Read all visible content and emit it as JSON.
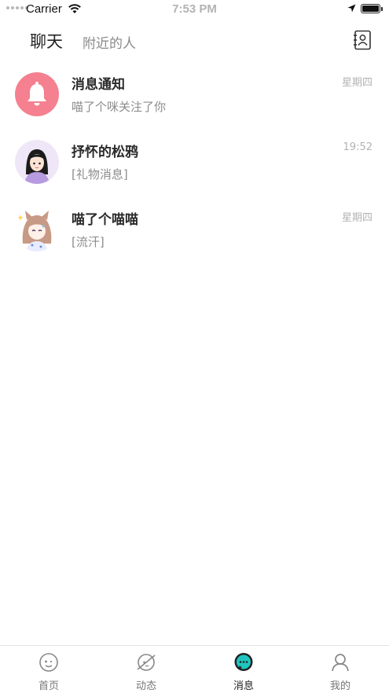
{
  "status_bar": {
    "carrier": "Carrier",
    "time": "7:53 PM"
  },
  "header": {
    "tab_chat": "聊天",
    "tab_nearby": "附近的人"
  },
  "conversations": [
    {
      "name": "消息通知",
      "preview": "喵了个咪关注了你",
      "time": "星期四",
      "avatar": "bell-icon"
    },
    {
      "name": "抒怀的松鸦",
      "preview": "[礼物消息]",
      "time": "19:52",
      "avatar": "girl-avatar"
    },
    {
      "name": "喵了个喵喵",
      "preview": "[流汗]",
      "time": "星期四",
      "avatar": "anime-girl-avatar"
    }
  ],
  "tabbar": {
    "items": [
      {
        "label": "首页",
        "icon": "home-icon"
      },
      {
        "label": "动态",
        "icon": "planet-icon"
      },
      {
        "label": "消息",
        "icon": "message-icon",
        "active": true
      },
      {
        "label": "我的",
        "icon": "profile-icon"
      }
    ]
  },
  "colors": {
    "notify_pink": "#f5808f",
    "accent_teal": "#1fc6c0"
  }
}
